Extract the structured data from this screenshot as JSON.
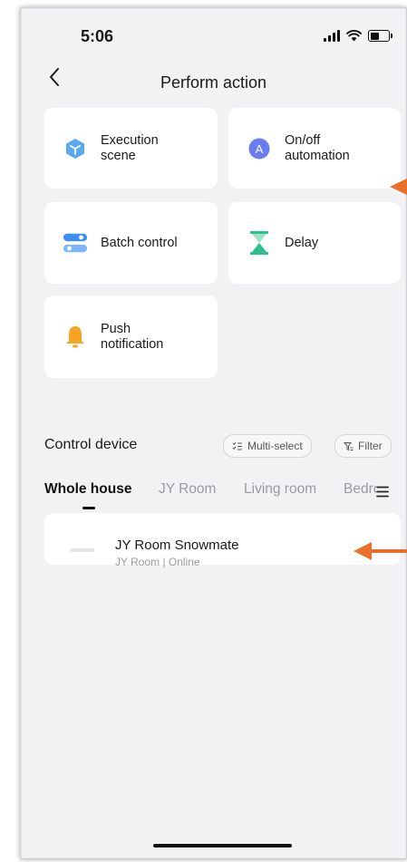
{
  "status_bar": {
    "time": "5:06"
  },
  "header": {
    "back_icon": "chevron-left-icon",
    "title": "Perform action"
  },
  "actions": [
    {
      "label": "Execution\nscene",
      "icon": "execution-scene-icon",
      "color": "#5aa9f0"
    },
    {
      "label": "On/off\nautomation",
      "icon": "automation-icon",
      "color": "#6b7cf0"
    },
    {
      "label": "Batch control",
      "icon": "batch-control-icon",
      "color": "#3d8ff5"
    },
    {
      "label": "Delay",
      "icon": "hourglass-icon",
      "color": "#2dbf8a"
    },
    {
      "label": "Push\nnotification",
      "icon": "bell-icon",
      "color": "#f5a524"
    }
  ],
  "control_device": {
    "title": "Control device",
    "multi_select_label": "Multi-select",
    "filter_label": "Filter"
  },
  "tabs": [
    {
      "label": "Whole house",
      "active": true
    },
    {
      "label": "JY Room",
      "active": false
    },
    {
      "label": "Living room",
      "active": false
    },
    {
      "label": "Bedrc",
      "active": false
    }
  ],
  "devices": [
    {
      "name": "JY Room Snowmate",
      "subtitle": "JY Room | Online"
    }
  ],
  "annotation_color": "#e8702a"
}
